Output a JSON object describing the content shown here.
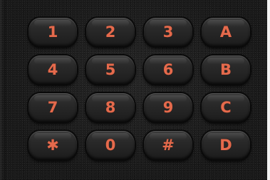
{
  "keypad": {
    "keys": [
      {
        "label": "1"
      },
      {
        "label": "2"
      },
      {
        "label": "3"
      },
      {
        "label": "A"
      },
      {
        "label": "4"
      },
      {
        "label": "5"
      },
      {
        "label": "6"
      },
      {
        "label": "B"
      },
      {
        "label": "7"
      },
      {
        "label": "8"
      },
      {
        "label": "9"
      },
      {
        "label": "C"
      },
      {
        "label": "✱"
      },
      {
        "label": "0"
      },
      {
        "label": "#"
      },
      {
        "label": "D"
      }
    ],
    "colors": {
      "label": "#e56a4c",
      "key": "#2a2a2a",
      "body": "#161616"
    }
  }
}
